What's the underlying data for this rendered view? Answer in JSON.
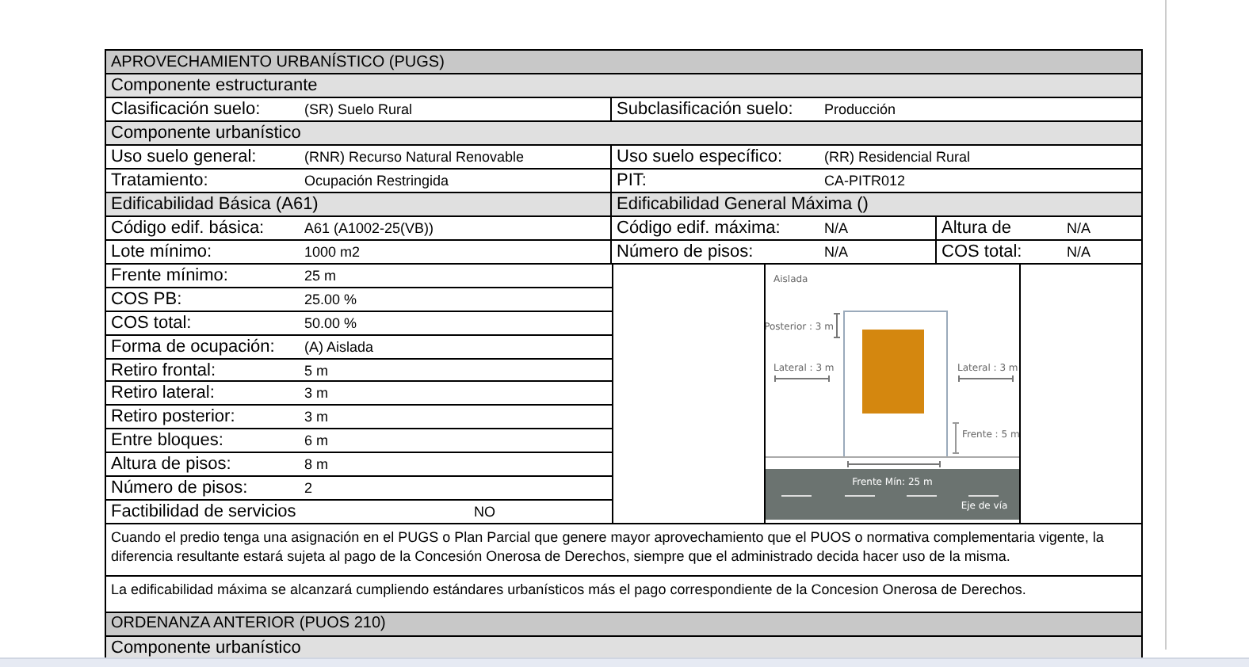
{
  "top_rows": [
    {
      "kind": "title",
      "text": "APROVECHAMIENTO URBANÍSTICO (PUGS)"
    },
    {
      "kind": "band",
      "text": "Componente  estructurante"
    },
    {
      "kind": "pair",
      "left": {
        "label": "Clasificación suelo:",
        "value": "(SR) Suelo Rural"
      },
      "right": {
        "label": "Subclasificación suelo:",
        "value": "Producción"
      }
    },
    {
      "kind": "band",
      "text": "Componente  urbanístico"
    },
    {
      "kind": "pair",
      "left": {
        "label": "Uso suelo general:",
        "value": "(RNR) Recurso Natural Renovable"
      },
      "right": {
        "label": "Uso suelo específico:",
        "value": "(RR) Residencial Rural"
      }
    },
    {
      "kind": "pair",
      "left": {
        "label": "Tratamiento:",
        "value": "Ocupación Restringida"
      },
      "right": {
        "label": "PIT:",
        "value": "CA-PITR012"
      }
    },
    {
      "kind": "split_band",
      "left": "Edificabilidad Básica (A61)",
      "right": "Edificabilidad General Máxima ()"
    },
    {
      "kind": "quad",
      "left": {
        "label": "Código edif. básica:",
        "value": "A61 (A1002-25(VB))"
      },
      "right": [
        {
          "label": "Código edif. máxima:",
          "value": "N/A"
        },
        {
          "label": "Altura de",
          "value": "N/A"
        }
      ]
    },
    {
      "kind": "quad",
      "left": {
        "label": "Lote mínimo:",
        "value": "1000 m2"
      },
      "right": [
        {
          "label": "Número de pisos:",
          "value": "N/A"
        },
        {
          "label": "COS total:",
          "value": "N/A"
        }
      ]
    }
  ],
  "lower_rows": [
    {
      "kind": "normal",
      "label": "Frente mínimo:",
      "value": "25 m"
    },
    {
      "kind": "normal",
      "label": "COS PB:",
      "value": "25.00 %"
    },
    {
      "kind": "normal",
      "label": "COS total:",
      "value": "50.00 %"
    },
    {
      "kind": "normal",
      "label": "Forma de ocupación:",
      "value": "(A) Aislada"
    },
    {
      "kind": "normal",
      "label": "Retiro frontal:",
      "value": "5 m"
    },
    {
      "kind": "normal",
      "label": "Retiro lateral:",
      "value": "3 m"
    },
    {
      "kind": "normal",
      "label": "Retiro posterior:",
      "value": "3 m"
    },
    {
      "kind": "normal",
      "label": "Entre bloques:",
      "value": "6 m"
    },
    {
      "kind": "normal",
      "label": "Altura de pisos:",
      "value": "8 m"
    },
    {
      "kind": "normal",
      "label": "Número de pisos:",
      "value": "2"
    },
    {
      "kind": "wide",
      "label": "Factibilidad de servicios",
      "value": "NO"
    }
  ],
  "diagram": {
    "type": "Aislada",
    "rear": "Posterior : 3 m",
    "side_left": "Lateral : 3 m",
    "side_right": "Lateral : 3 m",
    "front": "Frente : 5 m",
    "frontage": "Frente Mín: 25 m",
    "road_axis": "Eje de vía"
  },
  "notes": [
    "Cuando el predio tenga una asignación en el PUGS o Plan Parcial que genere mayor aprovechamiento que el PUOS o normativa complementaria vigente, la diferencia resultante estará sujeta al pago de la Concesión Onerosa de Derechos, siempre que el administrado decida hacer uso de la misma.",
    "La edificabilidad máxima se alcanzará cumpliendo estándares urbanísticos más el pago correspondiente de la Concesion Onerosa de Derechos."
  ],
  "previous": {
    "title": "ORDENANZA ANTERIOR (PUOS 210)",
    "subtitle": "Componente urbanístico"
  }
}
